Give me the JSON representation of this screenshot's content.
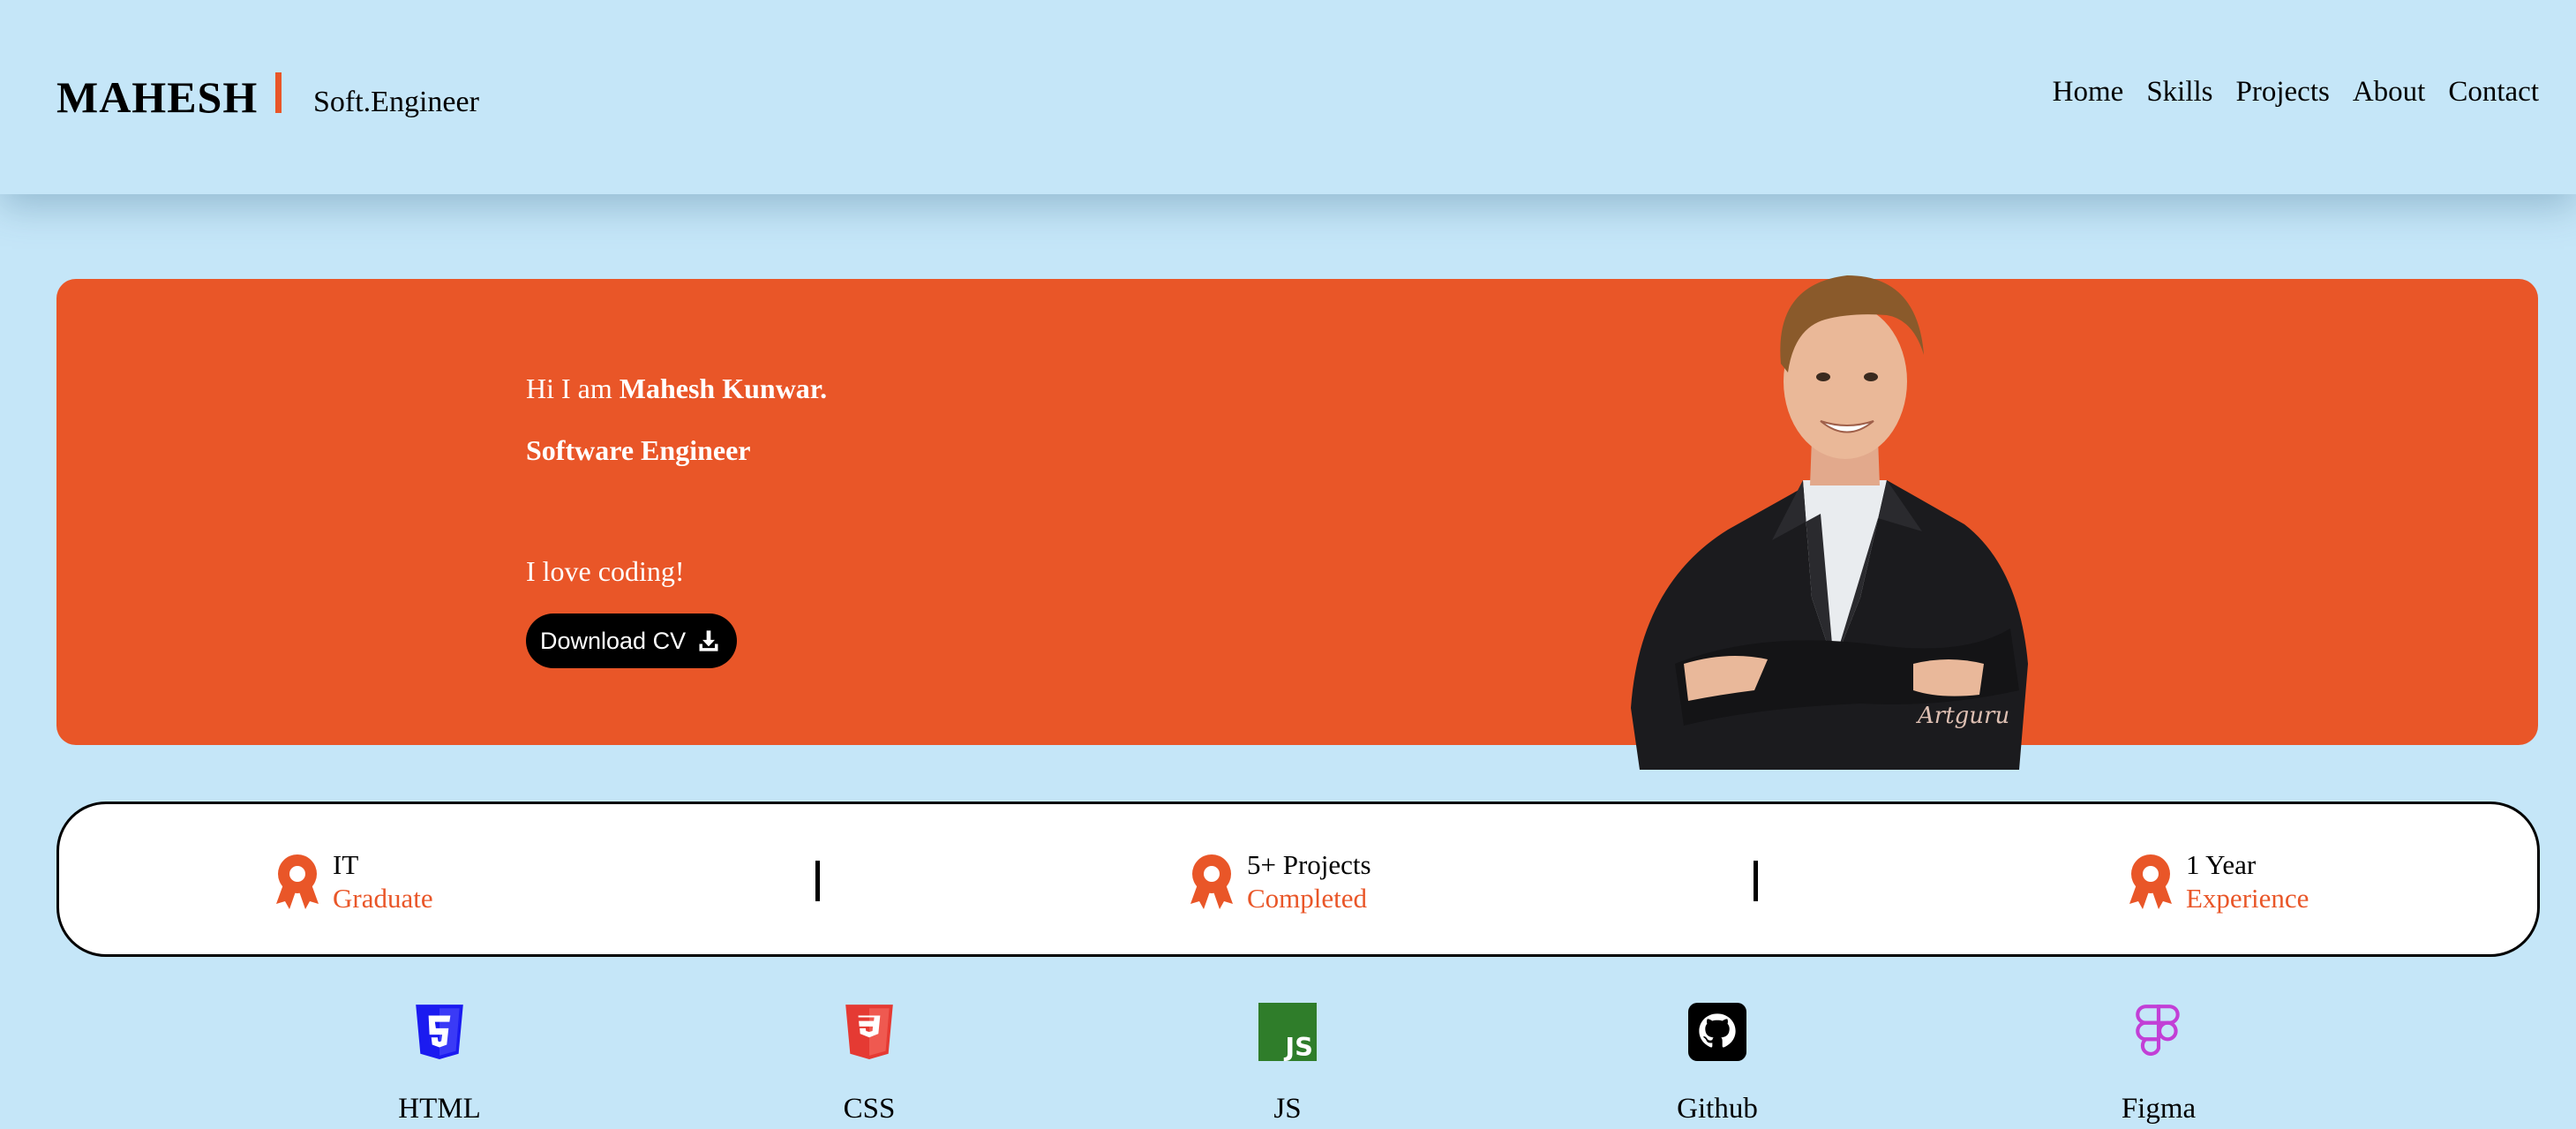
{
  "header": {
    "logo": "MAHESH",
    "tagline": "Soft.Engineer",
    "nav": [
      "Home",
      "Skills",
      "Projects",
      "About",
      "Contact"
    ]
  },
  "hero": {
    "greeting_prefix": "Hi I am ",
    "name": "Mahesh Kunwar.",
    "role": "Software Engineer",
    "tagline": "I love coding!",
    "button_label": "Download CV",
    "watermark": "Artguru",
    "accent_color": "#e95628"
  },
  "stats": [
    {
      "top": "IT",
      "bottom": "Graduate",
      "icon": "award-icon"
    },
    {
      "top": "5+ Projects",
      "bottom": "Completed",
      "icon": "award-icon"
    },
    {
      "top": "1 Year",
      "bottom": "Experience",
      "icon": "award-icon"
    }
  ],
  "skills": [
    {
      "label": "HTML",
      "icon": "html5-icon"
    },
    {
      "label": "CSS",
      "icon": "css3-icon"
    },
    {
      "label": "JS",
      "icon": "js-icon"
    },
    {
      "label": "Github",
      "icon": "github-icon"
    },
    {
      "label": "Figma",
      "icon": "figma-icon"
    }
  ]
}
